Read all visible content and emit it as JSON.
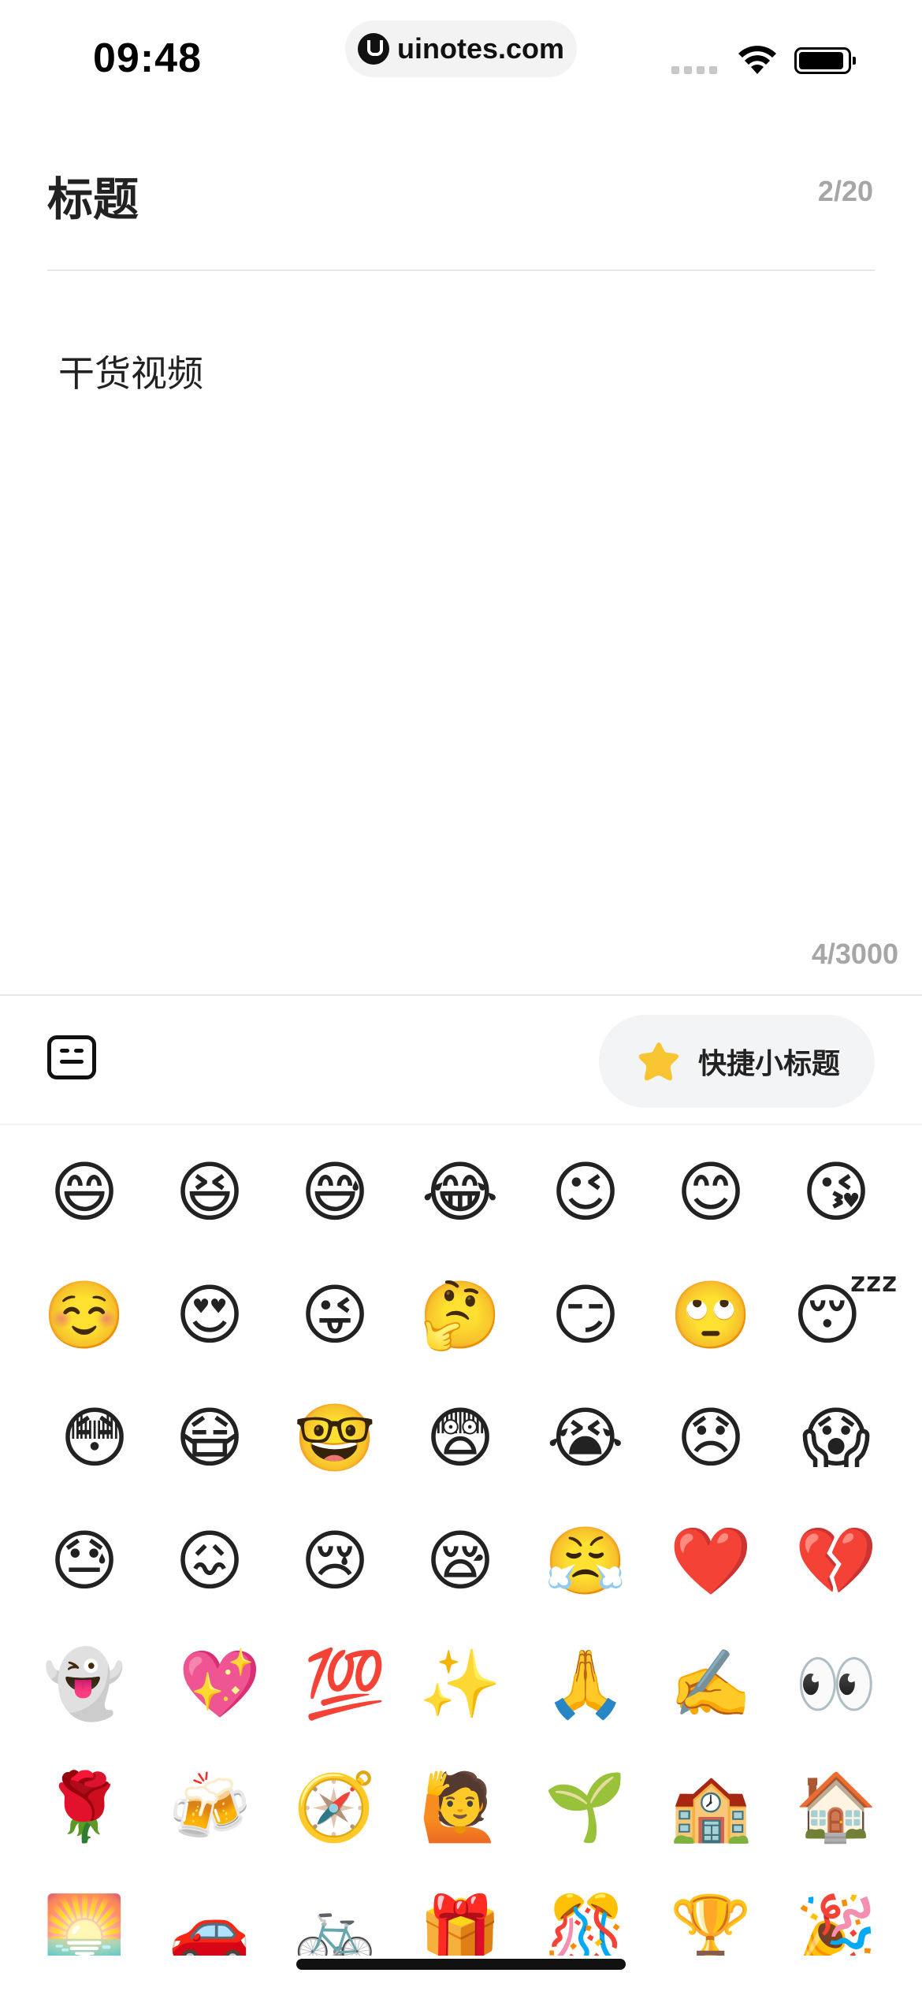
{
  "status_bar": {
    "time": "09:48",
    "url": "uinotes.com"
  },
  "editor": {
    "title_label": "标题",
    "title_count": "2/20",
    "body_text": "干货视频",
    "body_count": "4/3000"
  },
  "toolbar": {
    "format_icon": "list-format-icon",
    "quick_icon": "star-icon",
    "quick_label": "快捷小标题"
  },
  "emoji_rows": [
    [
      "😄",
      "😆",
      "😅",
      "😂",
      "😉",
      "😊",
      "😘"
    ],
    [
      "☺️",
      "😍",
      "😜",
      "🤔",
      "😏",
      "🙄",
      "😴"
    ],
    [
      "😳",
      "😷",
      "🤓",
      "😨",
      "😭",
      "😞",
      "😱"
    ],
    [
      "😓",
      "😖",
      "😢",
      "😪",
      "😤",
      "❤️",
      "💔"
    ],
    [
      "👻",
      "💖",
      "💯",
      "✨",
      "🙏",
      "✍️",
      "👀"
    ],
    [
      "🌹",
      "🍻",
      "🧭",
      "🙋",
      "🌱",
      "🏫",
      "🏠"
    ],
    [
      "🌅",
      "🚗",
      "🚲",
      "🎁",
      "🎊",
      "🏆",
      "🎉"
    ]
  ]
}
